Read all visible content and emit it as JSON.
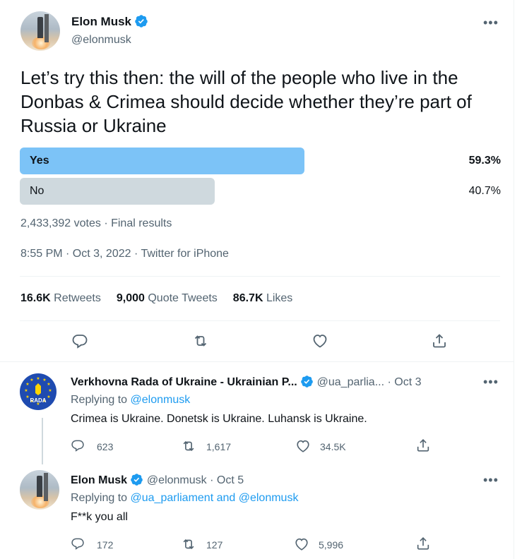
{
  "main_tweet": {
    "name": "Elon Musk",
    "handle": "@elonmusk",
    "more_icon": "more-horizontal-icon",
    "text": "Let’s try this then: the will of the people who live in the Donbas & Crimea should decide whether they’re part of Russia or Ukraine",
    "poll": {
      "options": [
        {
          "label": "Yes",
          "percent_text": "59.3%",
          "percent": 59.3,
          "winner": true
        },
        {
          "label": "No",
          "percent_text": "40.7%",
          "percent": 40.7,
          "winner": false
        }
      ],
      "summary": "2,433,392 votes · Final results"
    },
    "timestamp": "8:55 PM · Oct 3, 2022 · Twitter for iPhone",
    "stats": {
      "retweets_count": "16.6K",
      "retweets_label": "Retweets",
      "quotes_count": "9,000",
      "quotes_label": "Quote Tweets",
      "likes_count": "86.7K",
      "likes_label": "Likes"
    }
  },
  "replies": [
    {
      "name": "Verkhovna Rada of Ukraine - Ukrainian P...",
      "handle": "@ua_parlia...",
      "date": "· Oct 3",
      "avatar_text": "RADA",
      "replying_prefix": "Replying to",
      "replying_to": "@elonmusk",
      "text": "Crimea is Ukraine. Donetsk is Ukraine. Luhansk is Ukraine.",
      "reply_count": "623",
      "retweet_count": "1,617",
      "like_count": "34.5K"
    },
    {
      "name": "Elon Musk",
      "handle": "@elonmusk",
      "date": "· Oct 5",
      "replying_prefix": "Replying to",
      "replying_to": "@ua_parliament and @elonmusk",
      "text": "F**k you all",
      "reply_count": "172",
      "retweet_count": "127",
      "like_count": "5,996"
    }
  ],
  "colors": {
    "accent": "#1d9bf0",
    "poll_winner": "#7cc3f7",
    "poll_other": "#cfd9de",
    "secondary_text": "#536471"
  }
}
